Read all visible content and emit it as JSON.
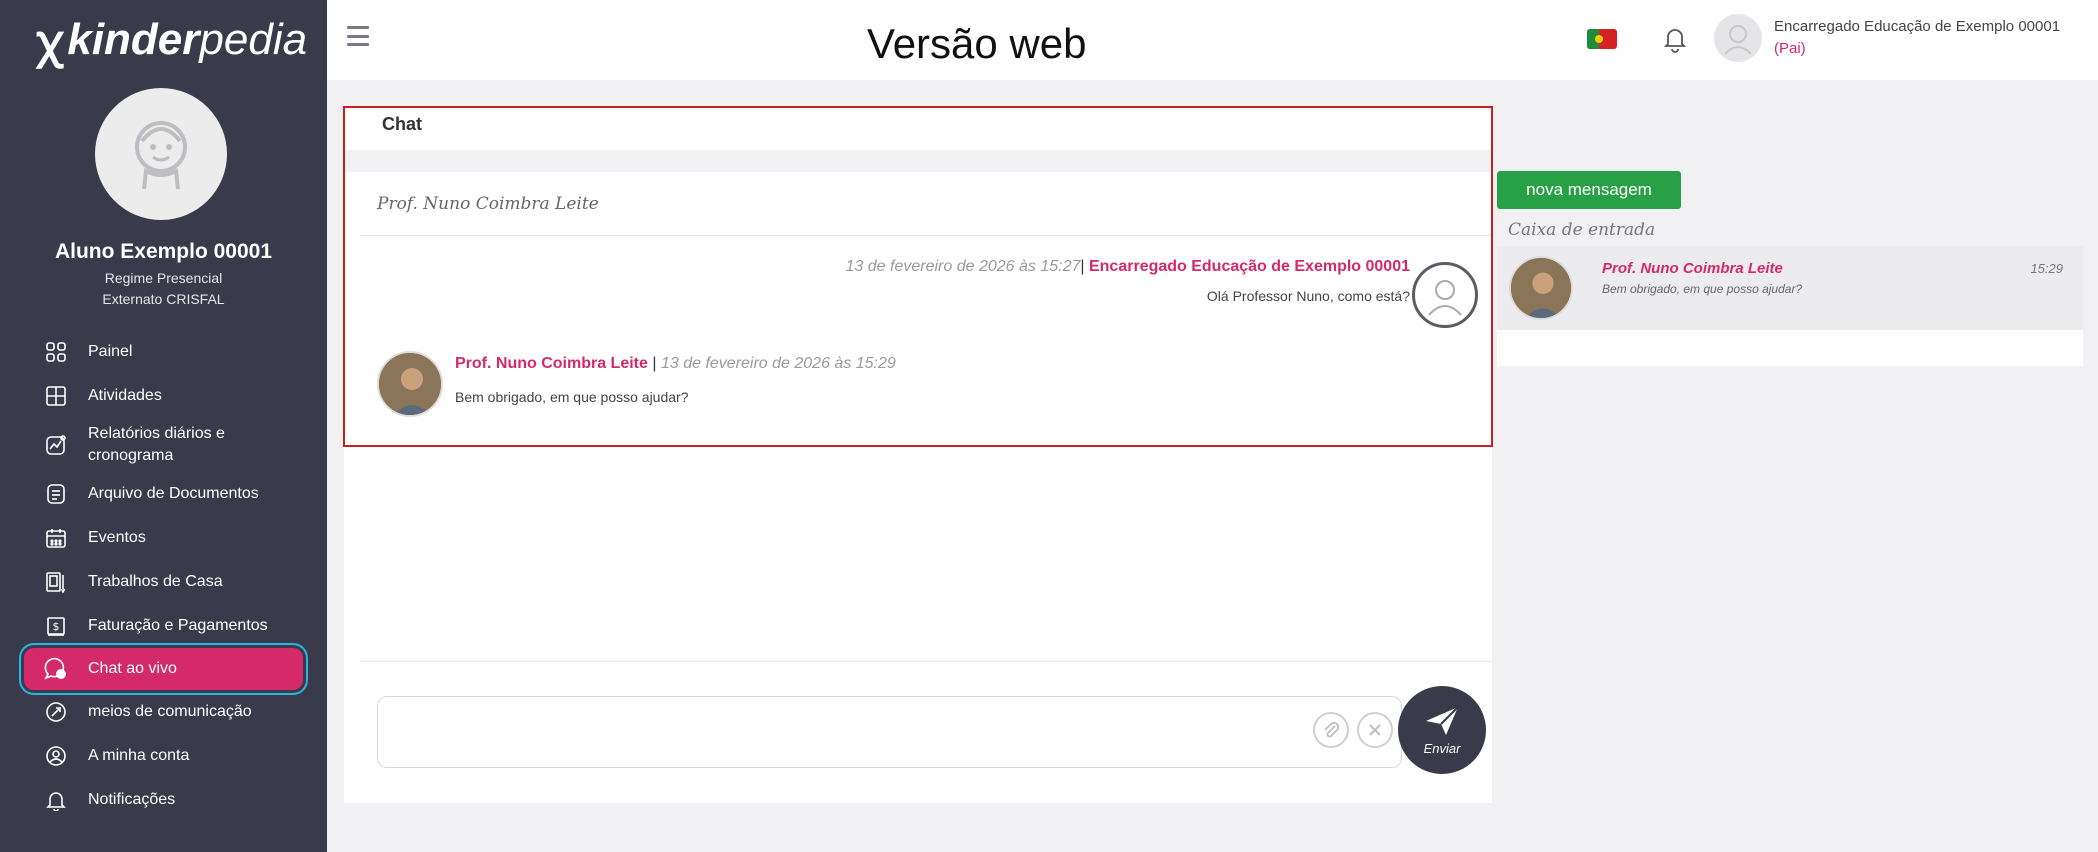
{
  "overlay_title": "Versão web",
  "sidebar": {
    "logo_mark": "ꭓ",
    "logo_bold": "kinder",
    "logo_light": "pedia",
    "student_name": "Aluno Exemplo 00001",
    "student_regime": "Regime Presencial",
    "student_school": "Externato CRISFAL",
    "items": [
      {
        "label": "Painel",
        "icon": "dashboard-icon"
      },
      {
        "label": "Atividades",
        "icon": "activities-icon"
      },
      {
        "label": "Relatórios diários e cronograma",
        "icon": "reports-icon"
      },
      {
        "label": "Arquivo de Documentos",
        "icon": "documents-icon"
      },
      {
        "label": "Eventos",
        "icon": "calendar-icon"
      },
      {
        "label": "Trabalhos de Casa",
        "icon": "homework-icon"
      },
      {
        "label": "Faturação e Pagamentos",
        "icon": "billing-icon"
      },
      {
        "label": "Chat ao vivo",
        "icon": "chat-icon",
        "active": true
      },
      {
        "label": "meios de comunicação",
        "icon": "media-icon"
      },
      {
        "label": "A minha conta",
        "icon": "account-icon"
      },
      {
        "label": "Notificações",
        "icon": "bell-icon"
      }
    ]
  },
  "header": {
    "user_name": "Encarregado Educação de Exemplo 00001",
    "user_role": "(Pai)",
    "flag": "portugal-flag-icon"
  },
  "chat": {
    "title": "Chat",
    "partner": "Prof. Nuno Coimbra Leite",
    "messages": [
      {
        "timestamp": "13 de fevereiro de 2026 às 15:27",
        "sender": "Encarregado Educação de Exemplo 00001",
        "text": "Olá Professor Nuno, como está?"
      },
      {
        "timestamp": "13 de fevereiro de 2026 às 15:29",
        "sender": "Prof. Nuno Coimbra Leite",
        "text": "Bem obrigado, em que posso ajudar?"
      }
    ],
    "compose_placeholder": "",
    "send_label": "Enviar"
  },
  "inbox": {
    "new_message_label": "nova mensagem",
    "label": "Caixa de entrada",
    "items": [
      {
        "name": "Prof. Nuno Coimbra Leite",
        "snippet": "Bem obrigado, em que posso ajudar?",
        "time": "15:29"
      }
    ]
  },
  "colors": {
    "accent": "#d42a6a",
    "sidebar": "#3a3b4a",
    "green": "#27a046",
    "highlight": "#c8201f"
  }
}
